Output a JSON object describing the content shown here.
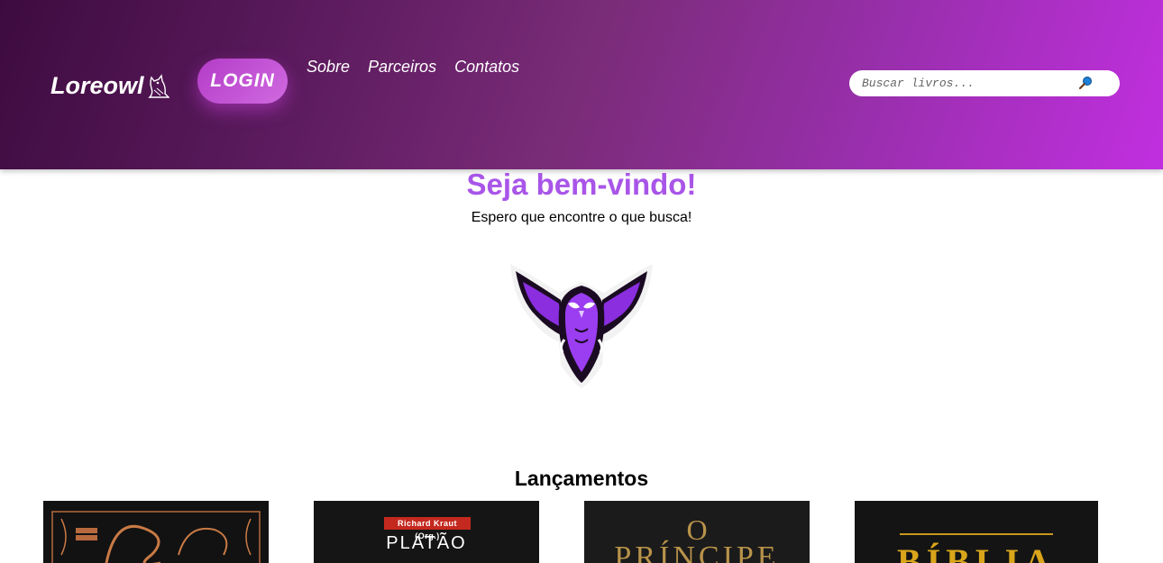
{
  "header": {
    "logo": "Loreowl",
    "login_label": "LOGIN",
    "nav": [
      {
        "label": "Sobre"
      },
      {
        "label": "Parceiros"
      },
      {
        "label": "Contatos"
      }
    ],
    "search": {
      "placeholder": "Buscar livros..."
    }
  },
  "main": {
    "title": "Seja bem-vindo!",
    "subtitle": "Espero que encontre o que busca!",
    "section_title": "Lançamentos",
    "books": [
      {
        "cover_text": ""
      },
      {
        "tag": "Richard Kraut (Org.)",
        "title": "PLATÃO"
      },
      {
        "small": "O",
        "title": "PRÍNCIPE"
      },
      {
        "title": "BÍBLIA"
      }
    ]
  },
  "colors": {
    "accent": "#a855e8",
    "header_start": "#3d0b3f",
    "header_end": "#c12fe0"
  }
}
